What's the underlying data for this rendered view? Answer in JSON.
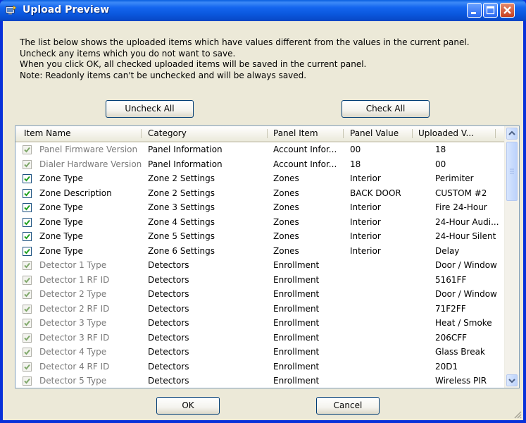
{
  "window": {
    "title": "Upload Preview",
    "colors": {
      "titlebar": "#0a56db",
      "frame": "#0831d9",
      "client": "#ece9d8",
      "close_button": "#c7401f"
    }
  },
  "description": {
    "lines": [
      "The list below shows the uploaded items which have values different from the values in the current panel.",
      "Uncheck any items which you do not want to save.",
      "When you click OK, all checked uploaded items will be saved in the current panel.",
      "Note: Readonly items can't be unchecked and will be always saved."
    ]
  },
  "buttons": {
    "uncheck_all": "Uncheck All",
    "check_all": "Check All",
    "ok": "OK",
    "cancel": "Cancel"
  },
  "list": {
    "columns": [
      "Item Name",
      "Category",
      "Panel Item",
      "Panel Value",
      "Uploaded V..."
    ],
    "rows": [
      {
        "checked": true,
        "readonly": true,
        "name": "Panel Firmware Version",
        "category": "Panel Information",
        "panel_item": "Account Infor...",
        "panel_value": "00",
        "uploaded": "18"
      },
      {
        "checked": true,
        "readonly": true,
        "name": "Dialer Hardware Version",
        "category": "Panel Information",
        "panel_item": "Account Infor...",
        "panel_value": "18",
        "uploaded": "00"
      },
      {
        "checked": true,
        "readonly": false,
        "name": "Zone Type",
        "category": "Zone 2 Settings",
        "panel_item": "Zones",
        "panel_value": "Interior",
        "uploaded": "Perimiter"
      },
      {
        "checked": true,
        "readonly": false,
        "name": "Zone Description",
        "category": "Zone 2 Settings",
        "panel_item": "Zones",
        "panel_value": "BACK DOOR",
        "uploaded": "CUSTOM #2"
      },
      {
        "checked": true,
        "readonly": false,
        "name": "Zone Type",
        "category": "Zone 3 Settings",
        "panel_item": "Zones",
        "panel_value": "Interior",
        "uploaded": "Fire 24-Hour"
      },
      {
        "checked": true,
        "readonly": false,
        "name": "Zone Type",
        "category": "Zone 4 Settings",
        "panel_item": "Zones",
        "panel_value": "Interior",
        "uploaded": "24-Hour Audi..."
      },
      {
        "checked": true,
        "readonly": false,
        "name": "Zone Type",
        "category": "Zone 5 Settings",
        "panel_item": "Zones",
        "panel_value": "Interior",
        "uploaded": "24-Hour Silent"
      },
      {
        "checked": true,
        "readonly": false,
        "name": "Zone Type",
        "category": "Zone 6 Settings",
        "panel_item": "Zones",
        "panel_value": "Interior",
        "uploaded": "Delay"
      },
      {
        "checked": true,
        "readonly": true,
        "name": "Detector 1 Type",
        "category": "Detectors",
        "panel_item": "Enrollment",
        "panel_value": "",
        "uploaded": "Door / Window"
      },
      {
        "checked": true,
        "readonly": true,
        "name": "Detector 1 RF ID",
        "category": "Detectors",
        "panel_item": "Enrollment",
        "panel_value": "",
        "uploaded": "5161FF"
      },
      {
        "checked": true,
        "readonly": true,
        "name": "Detector 2 Type",
        "category": "Detectors",
        "panel_item": "Enrollment",
        "panel_value": "",
        "uploaded": "Door / Window"
      },
      {
        "checked": true,
        "readonly": true,
        "name": "Detector 2 RF ID",
        "category": "Detectors",
        "panel_item": "Enrollment",
        "panel_value": "",
        "uploaded": "71F2FF"
      },
      {
        "checked": true,
        "readonly": true,
        "name": "Detector 3 Type",
        "category": "Detectors",
        "panel_item": "Enrollment",
        "panel_value": "",
        "uploaded": "Heat / Smoke"
      },
      {
        "checked": true,
        "readonly": true,
        "name": "Detector 3 RF ID",
        "category": "Detectors",
        "panel_item": "Enrollment",
        "panel_value": "",
        "uploaded": "206CFF"
      },
      {
        "checked": true,
        "readonly": true,
        "name": "Detector 4 Type",
        "category": "Detectors",
        "panel_item": "Enrollment",
        "panel_value": "",
        "uploaded": "Glass Break"
      },
      {
        "checked": true,
        "readonly": true,
        "name": "Detector 4 RF ID",
        "category": "Detectors",
        "panel_item": "Enrollment",
        "panel_value": "",
        "uploaded": "20D1"
      },
      {
        "checked": true,
        "readonly": true,
        "name": "Detector 5 Type",
        "category": "Detectors",
        "panel_item": "Enrollment",
        "panel_value": "",
        "uploaded": "Wireless PIR"
      }
    ]
  }
}
